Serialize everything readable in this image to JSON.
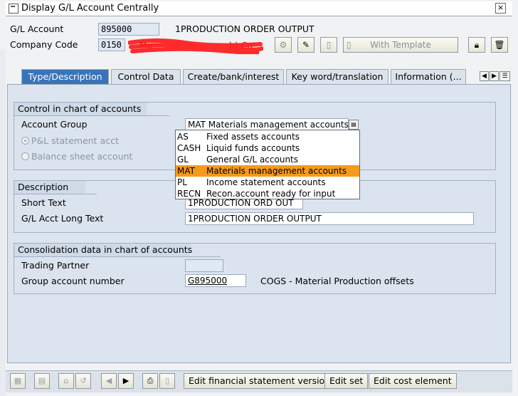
{
  "window": {
    "title": "Display G/L Account Centrally",
    "close_glyph": "×"
  },
  "header": {
    "gl_account_label": "G/L Account",
    "gl_account_value": "895000",
    "gl_account_description": "1PRODUCTION ORDER OUTPUT",
    "company_code_label": "Company Code",
    "company_code_value": "0150",
    "company_name_visible": "Mo",
    "company_name_suffix": "h) Co",
    "with_template_label": "With Template"
  },
  "tabs": [
    {
      "label": "Type/Description",
      "active": true
    },
    {
      "label": "Control Data",
      "active": false
    },
    {
      "label": "Create/bank/interest",
      "active": false
    },
    {
      "label": "Key word/translation",
      "active": false
    },
    {
      "label": "Information (...",
      "active": false
    }
  ],
  "control_group": {
    "title": "Control in chart of accounts",
    "account_group_label": "Account Group",
    "account_group_value": "MAT Materials management accounts",
    "pl_statement_label": "P&L statement acct",
    "balance_sheet_label": "Balance sheet account"
  },
  "account_group_options": [
    {
      "key": "AS",
      "text": "Fixed assets accounts",
      "selected": false
    },
    {
      "key": "CASH",
      "text": "Liquid funds accounts",
      "selected": false
    },
    {
      "key": "GL",
      "text": "General G/L accounts",
      "selected": false
    },
    {
      "key": "MAT",
      "text": "Materials management accounts",
      "selected": true
    },
    {
      "key": "PL",
      "text": "Income statement accounts",
      "selected": false
    },
    {
      "key": "RECN",
      "text": "Recon.account ready for input",
      "selected": false
    }
  ],
  "description_group": {
    "title": "Description",
    "short_text_label": "Short Text",
    "short_text_value": "1PRODUCTION ORD OUT",
    "long_text_label": "G/L Acct Long Text",
    "long_text_value": "1PRODUCTION ORDER OUTPUT"
  },
  "consolidation_group": {
    "title": "Consolidation data in chart of accounts",
    "trading_partner_label": "Trading Partner",
    "trading_partner_value": "",
    "group_account_label": "Group account number",
    "group_account_value": "G895000",
    "group_account_description": "COGS - Material Production offsets"
  },
  "bottom_toolbar": {
    "edit_fs_version": "Edit financial statement version",
    "edit_set": "Edit set",
    "edit_cost_element": "Edit cost element"
  },
  "colors": {
    "active_tab": "#3a74b8",
    "selected_option": "#f59a1a",
    "redaction": "#ff1a1a"
  }
}
